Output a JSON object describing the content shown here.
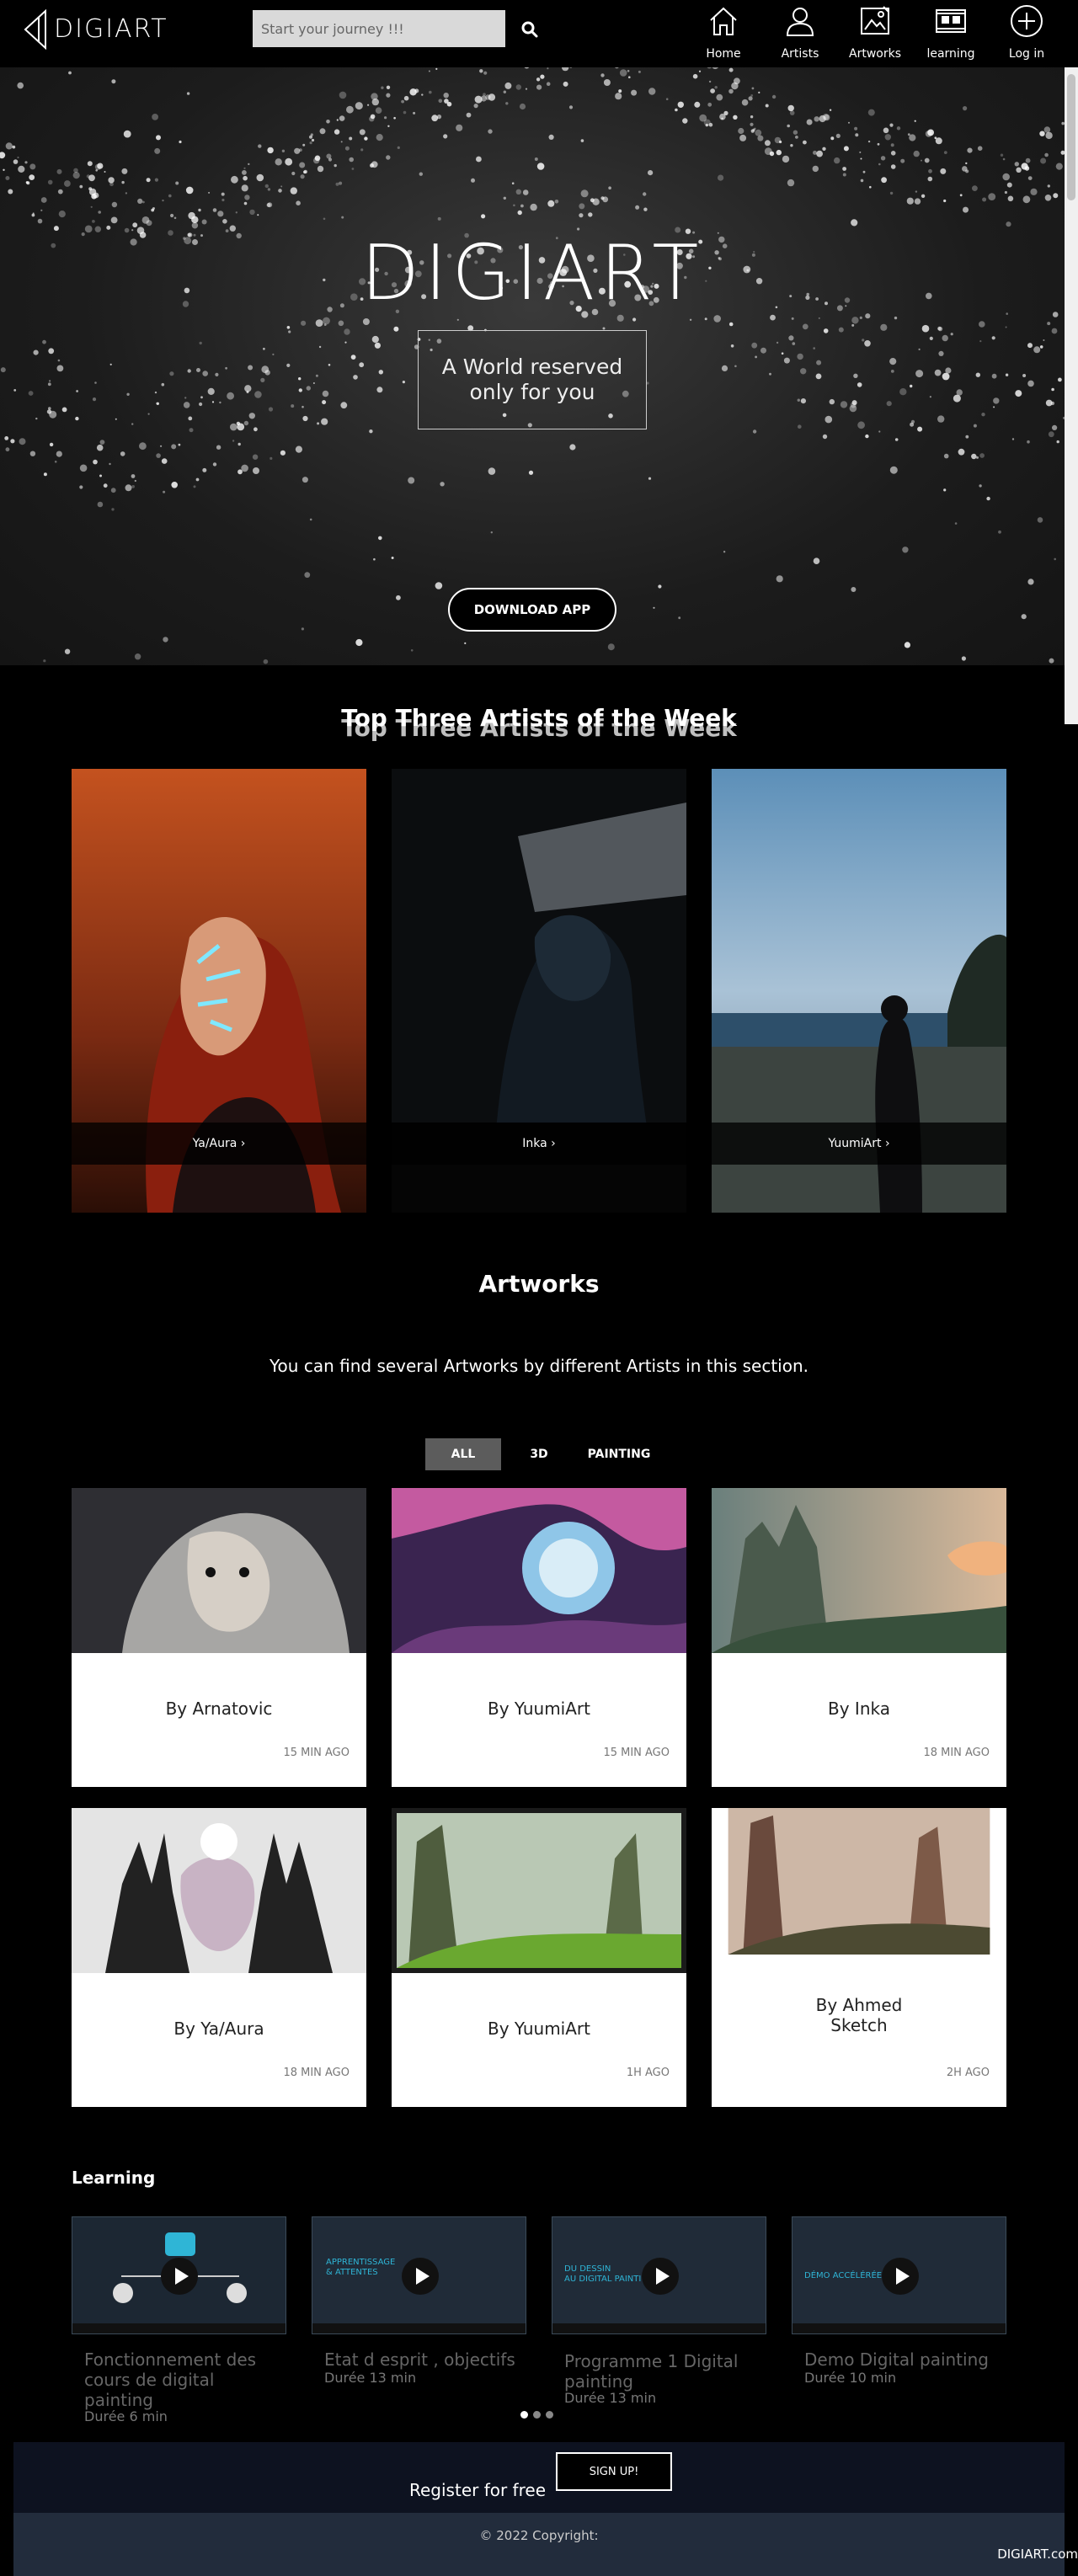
{
  "nav": {
    "brand": "DIGIART",
    "search_placeholder": "Start your journey !!!",
    "items": [
      {
        "label": "Home",
        "icon": "home-icon"
      },
      {
        "label": "Artists",
        "icon": "user-icon"
      },
      {
        "label": "Artworks",
        "icon": "image-icon"
      },
      {
        "label": "learning",
        "icon": "film-icon"
      },
      {
        "label": "Log in",
        "icon": "plus-circle-icon"
      }
    ]
  },
  "hero": {
    "title": "DIGIART",
    "tagline_line1": "A World reserved",
    "tagline_line2": "only for you",
    "button": "DOWNLOAD APP"
  },
  "top_artists": {
    "title": "Top Three Artists of the Week",
    "artists": [
      {
        "name": "Ya/Aura ›"
      },
      {
        "name": "Inka ›"
      },
      {
        "name": "YuumiArt ›"
      }
    ]
  },
  "artworks": {
    "title": "Artworks",
    "subtitle": "You can find several Artworks by different Artists in this section.",
    "filters": [
      "ALL",
      "3D",
      "PAINTING"
    ],
    "active_filter": "ALL",
    "cards": [
      {
        "by": "By Arnatovic",
        "time": "15 MIN AGO"
      },
      {
        "by": "By YuumiArt",
        "time": "15 MIN AGO"
      },
      {
        "by": "By Inka",
        "time": "18 MIN AGO"
      },
      {
        "by": "By Ya/Aura",
        "time": "18 MIN AGO"
      },
      {
        "by": "By YuumiArt",
        "time": "1H AGO"
      },
      {
        "by_line1": "By Ahmed",
        "by_line2": "Sketch",
        "time": "2H AGO"
      }
    ]
  },
  "learning": {
    "title": "Learning",
    "videos": [
      {
        "caption_l1": "Fonctionnement des",
        "caption_l2": "cours de digital",
        "caption_l3": "painting",
        "duration": "Durée 6 min",
        "thumb_text": ""
      },
      {
        "caption_l1": "Etat d esprit , objectifs",
        "duration": "Durée 13 min",
        "thumb_text_l1": "APPRENTISSAGE",
        "thumb_text_l2": "& ATTENTES"
      },
      {
        "caption_l1": "Programme 1 Digital",
        "caption_l2": "painting",
        "duration": "Durée 13 min",
        "thumb_text_l1": "DU DESSIN",
        "thumb_text_l2": "AU DIGITAL PAINTI"
      },
      {
        "caption_l1": "Demo Digital painting",
        "duration": "Durée 10 min",
        "thumb_text_l1": "DÉMO ACCÉLÉRÉE"
      }
    ]
  },
  "register": {
    "text": "Register for free",
    "button": "SIGN UP!"
  },
  "footer": {
    "copyright": "© 2022 Copyright:",
    "brand_link": "DIGIART.com"
  }
}
